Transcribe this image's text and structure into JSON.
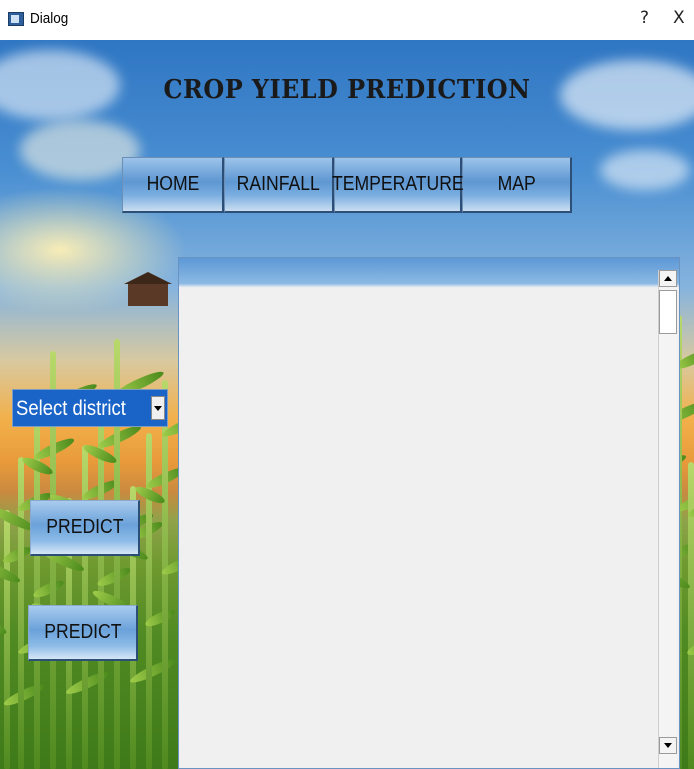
{
  "window": {
    "title": "Dialog",
    "help_label": "?",
    "close_label": "X"
  },
  "app": {
    "heading": "CROP YIELD PREDICTION"
  },
  "nav": {
    "items": [
      {
        "label": "HOME"
      },
      {
        "label": "RAINFALL"
      },
      {
        "label": "TEMPERATURE"
      },
      {
        "label": "MAP"
      }
    ]
  },
  "controls": {
    "district_select": {
      "value": "Select district"
    },
    "predict_button_1": "PREDICT",
    "predict_button_2": "PREDICT"
  },
  "colors": {
    "select_bg": "#1a64c8",
    "button_blue": "#6ba2da"
  }
}
